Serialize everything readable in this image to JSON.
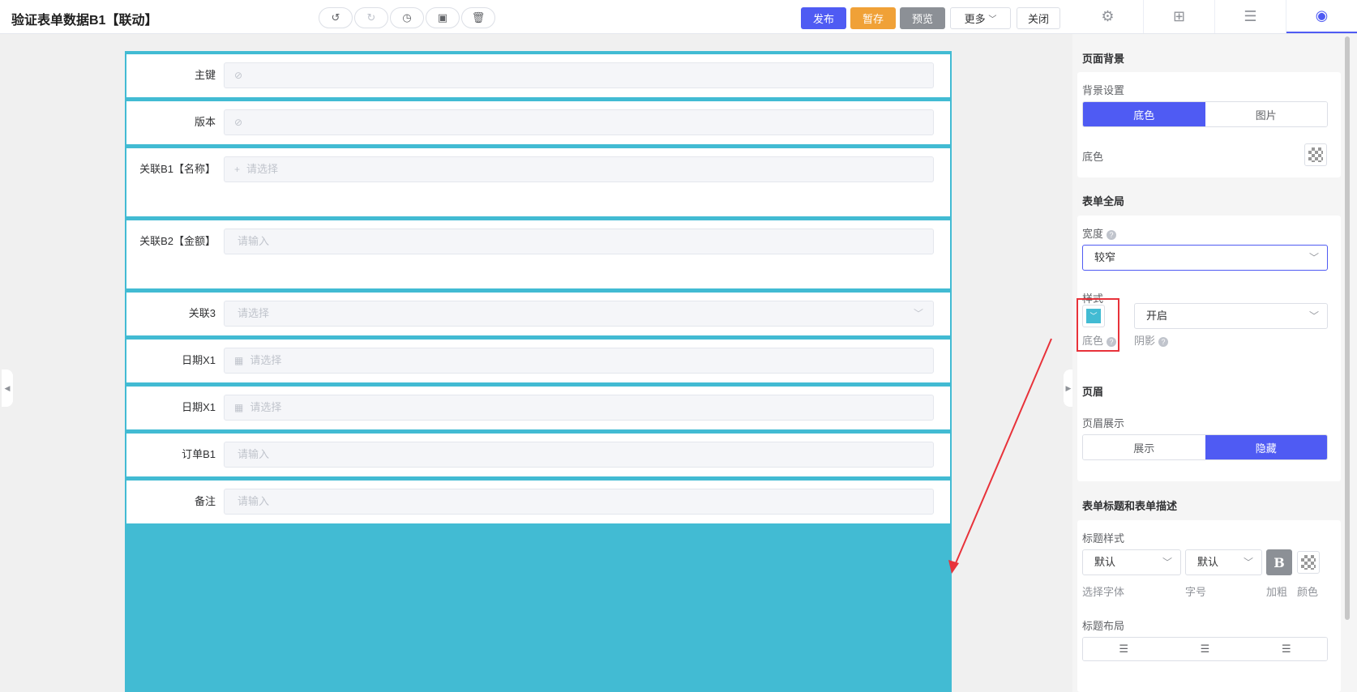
{
  "header": {
    "title": "验证表单数据B1【联动】",
    "tools": [
      {
        "icon": "undo-icon",
        "glyph": "↺"
      },
      {
        "icon": "redo-icon",
        "glyph": "↻"
      },
      {
        "icon": "history-icon",
        "glyph": "◷"
      },
      {
        "icon": "clipboard-icon",
        "glyph": "▣"
      },
      {
        "icon": "trash-icon",
        "glyph": "🗑"
      }
    ],
    "publish": "发布",
    "save_draft": "暂存",
    "preview": "预览",
    "more": "更多",
    "close": "关闭"
  },
  "right_tabs": [
    {
      "icon": "gear-icon",
      "glyph": "⚙"
    },
    {
      "icon": "grid-icon",
      "glyph": "⊞"
    },
    {
      "icon": "list-icon",
      "glyph": "☰"
    },
    {
      "icon": "palette-icon",
      "glyph": "◉",
      "active": true
    }
  ],
  "form": {
    "accent": "#42bbd3",
    "fields": [
      {
        "label": "主键",
        "placeholder": "",
        "icon": "eye-off-icon",
        "glyph": "⊘"
      },
      {
        "label": "版本",
        "placeholder": "",
        "icon": "eye-off-icon",
        "glyph": "⊘"
      },
      {
        "label": "关联B1【名称】",
        "placeholder": "请选择",
        "icon": "plus-icon",
        "glyph": "+"
      },
      {
        "label": "关联B2【金额】",
        "placeholder": "请输入",
        "icon": "",
        "glyph": ""
      },
      {
        "label": "关联3",
        "placeholder": "请选择",
        "icon": "",
        "glyph": "",
        "dropdown": true
      },
      {
        "label": "日期X1",
        "placeholder": "请选择",
        "icon": "calendar-icon",
        "glyph": "▦"
      },
      {
        "label": "日期X1",
        "placeholder": "请选择",
        "icon": "calendar-icon",
        "glyph": "▦"
      },
      {
        "label": "订单B1",
        "placeholder": "请输入",
        "icon": "",
        "glyph": ""
      },
      {
        "label": "备注",
        "placeholder": "请输入",
        "icon": "",
        "glyph": ""
      }
    ]
  },
  "panel": {
    "page_bg": {
      "heading": "页面背景",
      "setting_label": "背景设置",
      "options": [
        "底色",
        "图片"
      ],
      "selected": "底色",
      "color_label": "底色"
    },
    "form_global": {
      "heading": "表单全局",
      "width_label": "宽度",
      "width_value": "较窄",
      "style_label": "样式",
      "style_color_label": "底色",
      "shadow_value": "开启",
      "shadow_label": "阴影",
      "swatch_color": "#42bbd3"
    },
    "header_sec": {
      "heading": "页眉",
      "display_label": "页眉展示",
      "options": [
        "展示",
        "隐藏"
      ],
      "selected": "隐藏"
    },
    "title_sec": {
      "heading": "表单标题和表单描述",
      "title_style_label": "标题样式",
      "font_value": "默认",
      "size_value": "默认",
      "bold_glyph": "B",
      "font_caption": "选择字体",
      "size_caption": "字号",
      "bold_caption": "加粗",
      "color_caption": "颜色",
      "layout_label": "标题布局"
    }
  },
  "colors": {
    "brand": "#4f5bf3",
    "draft": "#f0a137",
    "preview": "#8c9096",
    "highlight": "#e8323a"
  }
}
